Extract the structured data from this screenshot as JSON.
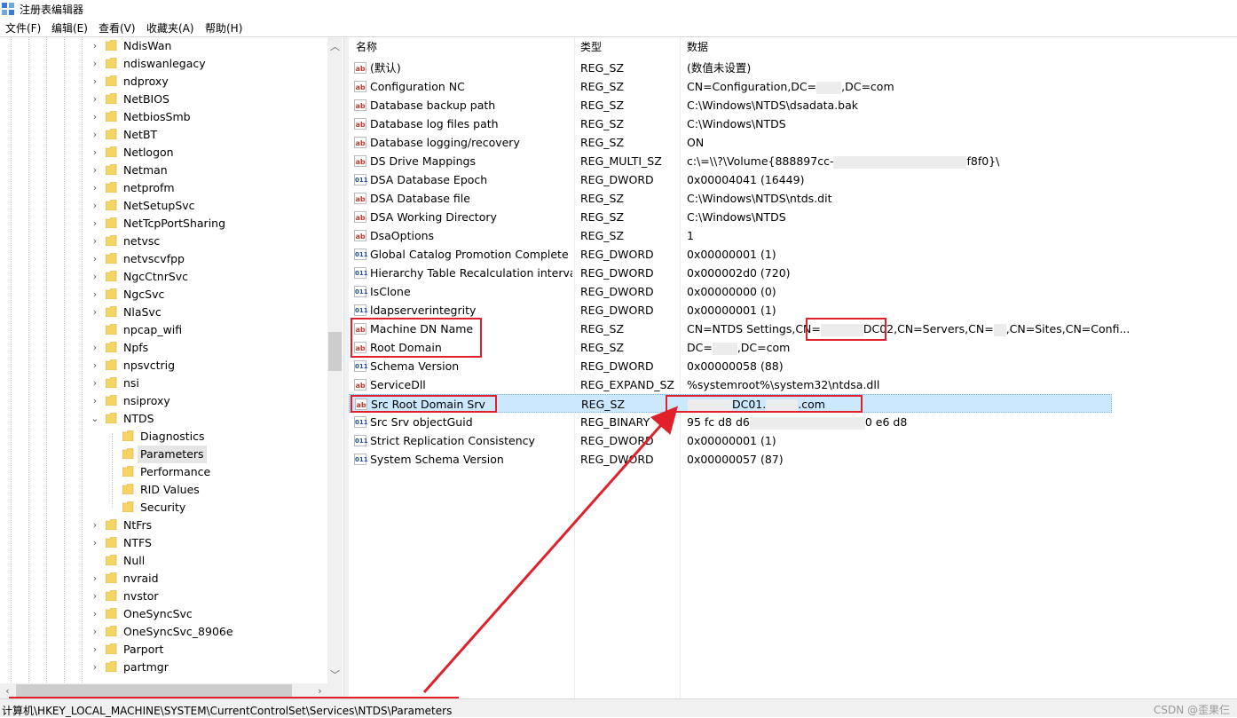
{
  "window": {
    "title": "注册表编辑器"
  },
  "menu": [
    "文件(F)",
    "编辑(E)",
    "查看(V)",
    "收藏夹(A)",
    "帮助(H)"
  ],
  "tree": {
    "items": [
      {
        "label": "NdisWan",
        "level": 1,
        "expander": "›"
      },
      {
        "label": "ndiswanlegacy",
        "level": 1,
        "expander": "›"
      },
      {
        "label": "ndproxy",
        "level": 1,
        "expander": "›"
      },
      {
        "label": "NetBIOS",
        "level": 1,
        "expander": "›"
      },
      {
        "label": "NetbiosSmb",
        "level": 1,
        "expander": "›"
      },
      {
        "label": "NetBT",
        "level": 1,
        "expander": "›"
      },
      {
        "label": "Netlogon",
        "level": 1,
        "expander": "›"
      },
      {
        "label": "Netman",
        "level": 1,
        "expander": "›"
      },
      {
        "label": "netprofm",
        "level": 1,
        "expander": "›"
      },
      {
        "label": "NetSetupSvc",
        "level": 1,
        "expander": "›"
      },
      {
        "label": "NetTcpPortSharing",
        "level": 1,
        "expander": "›"
      },
      {
        "label": "netvsc",
        "level": 1,
        "expander": "›"
      },
      {
        "label": "netvscvfpp",
        "level": 1,
        "expander": "›"
      },
      {
        "label": "NgcCtnrSvc",
        "level": 1,
        "expander": "›"
      },
      {
        "label": "NgcSvc",
        "level": 1,
        "expander": "›"
      },
      {
        "label": "NlaSvc",
        "level": 1,
        "expander": "›"
      },
      {
        "label": "npcap_wifi",
        "level": 1,
        "expander": ""
      },
      {
        "label": "Npfs",
        "level": 1,
        "expander": "›"
      },
      {
        "label": "npsvctrig",
        "level": 1,
        "expander": "›"
      },
      {
        "label": "nsi",
        "level": 1,
        "expander": "›"
      },
      {
        "label": "nsiproxy",
        "level": 1,
        "expander": "›"
      },
      {
        "label": "NTDS",
        "level": 1,
        "expander": "⌄"
      },
      {
        "label": "Diagnostics",
        "level": 2,
        "expander": ""
      },
      {
        "label": "Parameters",
        "level": 2,
        "expander": "",
        "selected": true
      },
      {
        "label": "Performance",
        "level": 2,
        "expander": ""
      },
      {
        "label": "RID Values",
        "level": 2,
        "expander": ""
      },
      {
        "label": "Security",
        "level": 2,
        "expander": ""
      },
      {
        "label": "NtFrs",
        "level": 1,
        "expander": "›"
      },
      {
        "label": "NTFS",
        "level": 1,
        "expander": "›"
      },
      {
        "label": "Null",
        "level": 1,
        "expander": ""
      },
      {
        "label": "nvraid",
        "level": 1,
        "expander": "›"
      },
      {
        "label": "nvstor",
        "level": 1,
        "expander": "›"
      },
      {
        "label": "OneSyncSvc",
        "level": 1,
        "expander": "›"
      },
      {
        "label": "OneSyncSvc_8906e",
        "level": 1,
        "expander": "›"
      },
      {
        "label": "Parport",
        "level": 1,
        "expander": "›"
      },
      {
        "label": "partmgr",
        "level": 1,
        "expander": "›"
      }
    ]
  },
  "list": {
    "headers": {
      "name": "名称",
      "type": "类型",
      "data": "数据"
    },
    "rows": [
      {
        "icon": "ab",
        "name": "(默认)",
        "type": "REG_SZ",
        "data": "(数值未设置)"
      },
      {
        "icon": "ab",
        "name": "Configuration NC",
        "type": "REG_SZ",
        "data_parts": [
          "CN=Configuration,DC=",
          "",
          ",DC=com"
        ]
      },
      {
        "icon": "ab",
        "name": "Database backup path",
        "type": "REG_SZ",
        "data": "C:\\Windows\\NTDS\\dsadata.bak"
      },
      {
        "icon": "ab",
        "name": "Database log files path",
        "type": "REG_SZ",
        "data": "C:\\Windows\\NTDS"
      },
      {
        "icon": "ab",
        "name": "Database logging/recovery",
        "type": "REG_SZ",
        "data": "ON"
      },
      {
        "icon": "ab",
        "name": "DS Drive Mappings",
        "type": "REG_MULTI_SZ",
        "data_parts": [
          "c:\\=\\\\?\\Volume{888897cc-",
          "",
          "f8f0}\\"
        ]
      },
      {
        "icon": "bin",
        "name": "DSA Database Epoch",
        "type": "REG_DWORD",
        "data": "0x00004041 (16449)"
      },
      {
        "icon": "ab",
        "name": "DSA Database file",
        "type": "REG_SZ",
        "data": "C:\\Windows\\NTDS\\ntds.dit"
      },
      {
        "icon": "ab",
        "name": "DSA Working Directory",
        "type": "REG_SZ",
        "data": "C:\\Windows\\NTDS"
      },
      {
        "icon": "ab",
        "name": "DsaOptions",
        "type": "REG_SZ",
        "data": "1"
      },
      {
        "icon": "bin",
        "name": "Global Catalog Promotion Complete",
        "type": "REG_DWORD",
        "data": "0x00000001 (1)"
      },
      {
        "icon": "bin",
        "name": "Hierarchy Table Recalculation interval...",
        "type": "REG_DWORD",
        "data": "0x000002d0 (720)"
      },
      {
        "icon": "bin",
        "name": "IsClone",
        "type": "REG_DWORD",
        "data": "0x00000000 (0)"
      },
      {
        "icon": "bin",
        "name": "ldapserverintegrity",
        "type": "REG_DWORD",
        "data": "0x00000001 (1)"
      },
      {
        "icon": "ab",
        "name": "Machine DN Name",
        "type": "REG_SZ",
        "data_parts": [
          "CN=NTDS Settings,CN=",
          "",
          "DC02,CN=Servers,CN=",
          "",
          ",CN=Sites,CN=Confi..."
        ]
      },
      {
        "icon": "ab",
        "name": "Root Domain",
        "type": "REG_SZ",
        "data_parts": [
          "DC=",
          "",
          ",DC=com"
        ]
      },
      {
        "icon": "bin",
        "name": "Schema Version",
        "type": "REG_DWORD",
        "data": "0x00000058 (88)"
      },
      {
        "icon": "ab",
        "name": "ServiceDll",
        "type": "REG_EXPAND_SZ",
        "data": "%systemroot%\\system32\\ntdsa.dll"
      },
      {
        "icon": "ab",
        "name": "Src Root Domain Srv",
        "type": "REG_SZ",
        "data_parts": [
          "",
          "DC01.",
          "",
          ".com"
        ],
        "selected": true
      },
      {
        "icon": "bin",
        "name": "Src Srv objectGuid",
        "type": "REG_BINARY",
        "data_parts": [
          "95 fc d8 d6",
          "",
          "0 e6 d8"
        ]
      },
      {
        "icon": "bin",
        "name": "Strict Replication Consistency",
        "type": "REG_DWORD",
        "data": "0x00000001 (1)"
      },
      {
        "icon": "bin",
        "name": "System Schema Version",
        "type": "REG_DWORD",
        "data": "0x00000057 (87)"
      }
    ]
  },
  "status": {
    "path": "计算机\\HKEY_LOCAL_MACHINE\\SYSTEM\\CurrentControlSet\\Services\\NTDS\\Parameters"
  },
  "watermark": "CSDN @歪果仨",
  "colors": {
    "selection": "#cce8ff",
    "annotation": "#e0202a",
    "string_icon": "#c0392b",
    "binary_icon": "#1f4fa3"
  }
}
